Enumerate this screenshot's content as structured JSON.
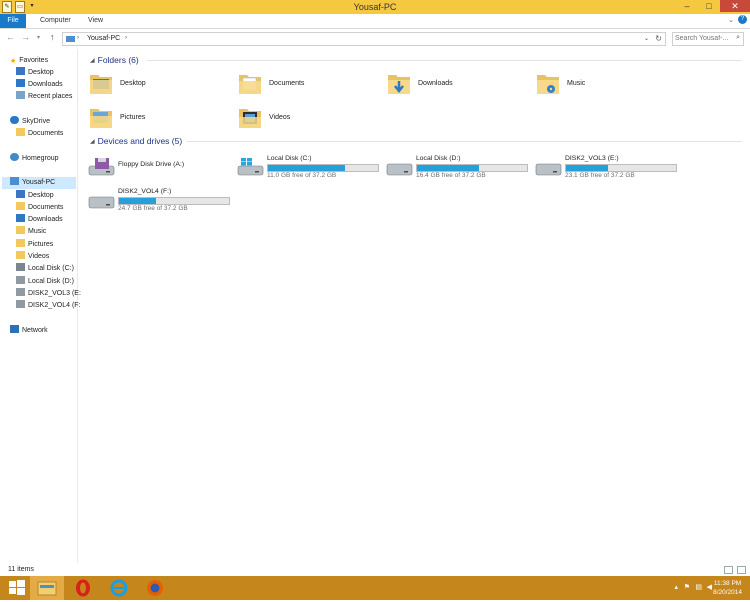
{
  "window": {
    "title": "Yousaf-PC"
  },
  "ribbon": {
    "tabs": [
      "File",
      "Computer",
      "View"
    ]
  },
  "address": {
    "crumbs": [
      "Yousaf-PC"
    ]
  },
  "search": {
    "placeholder": "Search Yousaf-..."
  },
  "sidebar": {
    "items": [
      {
        "label": "Favorites",
        "icon": "star-icon"
      },
      {
        "label": "Desktop",
        "icon": "desktop-icon"
      },
      {
        "label": "Downloads",
        "icon": "downloads-icon"
      },
      {
        "label": "Recent places",
        "icon": "recent-places-icon"
      },
      {
        "label": "SkyDrive",
        "icon": "cloud-icon"
      },
      {
        "label": "Documents",
        "icon": "documents-icon"
      },
      {
        "label": "Homegroup",
        "icon": "homegroup-icon"
      },
      {
        "label": "Yousaf-PC",
        "icon": "computer-icon"
      },
      {
        "label": "Desktop",
        "icon": "desktop-icon"
      },
      {
        "label": "Documents",
        "icon": "documents-icon"
      },
      {
        "label": "Downloads",
        "icon": "downloads-icon"
      },
      {
        "label": "Music",
        "icon": "music-icon"
      },
      {
        "label": "Pictures",
        "icon": "pictures-icon"
      },
      {
        "label": "Videos",
        "icon": "videos-icon"
      },
      {
        "label": "Local Disk (C:)",
        "icon": "drive-windows-icon"
      },
      {
        "label": "Local Disk (D:)",
        "icon": "drive-icon"
      },
      {
        "label": "DISK2_VOL3 (E:",
        "icon": "drive-icon"
      },
      {
        "label": "DISK2_VOL4 (F:",
        "icon": "drive-icon"
      },
      {
        "label": "Network",
        "icon": "network-icon"
      }
    ]
  },
  "folders": {
    "header": "Folders (6)",
    "items": [
      {
        "name": "Desktop",
        "icon": "desktop-folder-icon"
      },
      {
        "name": "Documents",
        "icon": "documents-folder-icon"
      },
      {
        "name": "Downloads",
        "icon": "downloads-folder-icon"
      },
      {
        "name": "Music",
        "icon": "music-folder-icon"
      },
      {
        "name": "Pictures",
        "icon": "pictures-folder-icon"
      },
      {
        "name": "Videos",
        "icon": "videos-folder-icon"
      }
    ]
  },
  "drives": {
    "header": "Devices and drives (5)",
    "items": [
      {
        "name": "Floppy Disk Drive (A:)",
        "free": "",
        "used_fraction": null,
        "icon": "floppy-drive-icon"
      },
      {
        "name": "Local Disk (C:)",
        "free": "11.0 GB free of 37.2 GB",
        "used_fraction": 0.7,
        "icon": "windows-drive-icon"
      },
      {
        "name": "Local Disk (D:)",
        "free": "16.4 GB free of 37.2 GB",
        "used_fraction": 0.56,
        "icon": "hard-drive-icon"
      },
      {
        "name": "DISK2_VOL3 (E:)",
        "free": "23.1 GB free of 37.2 GB",
        "used_fraction": 0.38,
        "icon": "hard-drive-icon"
      },
      {
        "name": "DISK2_VOL4 (F:)",
        "free": "24.7 GB free of 37.2 GB",
        "used_fraction": 0.34,
        "icon": "hard-drive-icon"
      }
    ]
  },
  "status": {
    "items_count": "11 items"
  },
  "taskbar": {
    "apps": [
      "start-icon",
      "file-explorer-icon",
      "opera-icon",
      "internet-explorer-icon",
      "firefox-icon"
    ],
    "time": "11:38 PM",
    "date": "8/20/2014"
  },
  "colors": {
    "accent": "#1979ca",
    "title_bar": "#f5c93f",
    "taskbar": "#c5861c",
    "drive_bar": "#26a0da"
  }
}
